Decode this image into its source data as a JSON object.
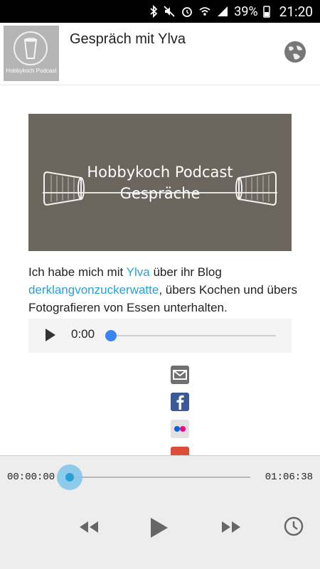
{
  "status_bar": {
    "battery": "39%",
    "time": "21:20"
  },
  "header": {
    "thumbnail_text": "Hobbykoch Podcast",
    "title": "Gespräch mit Ylva",
    "globe_icon": "globe-icon"
  },
  "banner": {
    "title": "Hobbykoch Podcast",
    "subtitle": "Gespräche"
  },
  "description": {
    "part1": "Ich habe mich mit ",
    "link1": "Ylva",
    "part2": " über ihr Blog ",
    "link2": "derklangvonzuckerwatte",
    "part3": ", übers Kochen und übers Fotografieren von Essen unterhalten."
  },
  "audio_player": {
    "time": "0:00"
  },
  "share": {
    "icons": [
      "mail-icon",
      "facebook-icon",
      "flickr-icon",
      "google-plus-icon"
    ]
  },
  "player_bar": {
    "current_time": "00:00:00",
    "total_time": "01:06:38",
    "progress": 0
  },
  "colors": {
    "link": "#2a9fd6",
    "banner_bg": "#6c655e",
    "accent": "#2a9fd6"
  }
}
